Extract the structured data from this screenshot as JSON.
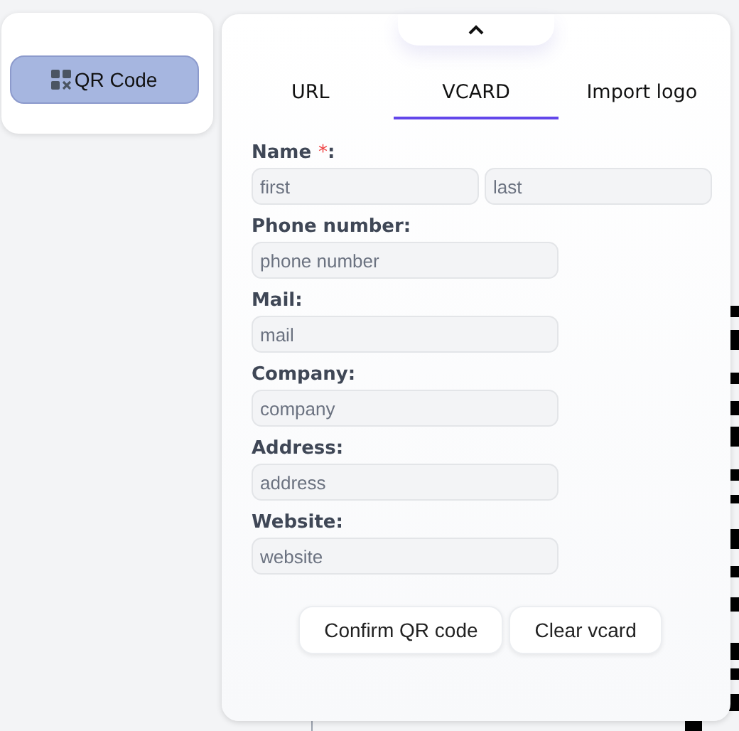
{
  "sidebar": {
    "button": {
      "label": "QR Code",
      "selected": true
    }
  },
  "panel": {
    "collapsed": false,
    "tabs": [
      {
        "label": "URL",
        "selected": false
      },
      {
        "label": "VCARD",
        "selected": true
      },
      {
        "label": "Import logo",
        "selected": false
      }
    ],
    "fields": [
      {
        "kind": "pair",
        "label": "Name",
        "required": "*",
        "label_end": ":",
        "inputs": [
          {
            "placeholder": "first"
          },
          {
            "placeholder": "last"
          }
        ]
      },
      {
        "kind": "single",
        "label": "Phone number:",
        "inputs": [
          {
            "placeholder": "phone number"
          }
        ]
      },
      {
        "kind": "single",
        "label": "Mail:",
        "inputs": [
          {
            "placeholder": "mail"
          }
        ]
      },
      {
        "kind": "single",
        "label": "Company:",
        "inputs": [
          {
            "placeholder": "company"
          }
        ]
      },
      {
        "kind": "single",
        "label": "Address:",
        "inputs": [
          {
            "placeholder": "address"
          }
        ]
      },
      {
        "kind": "single",
        "label": "Website:",
        "inputs": [
          {
            "placeholder": "website"
          }
        ]
      }
    ],
    "buttons": [
      "Confirm QR code",
      "Clear vcard"
    ]
  }
}
